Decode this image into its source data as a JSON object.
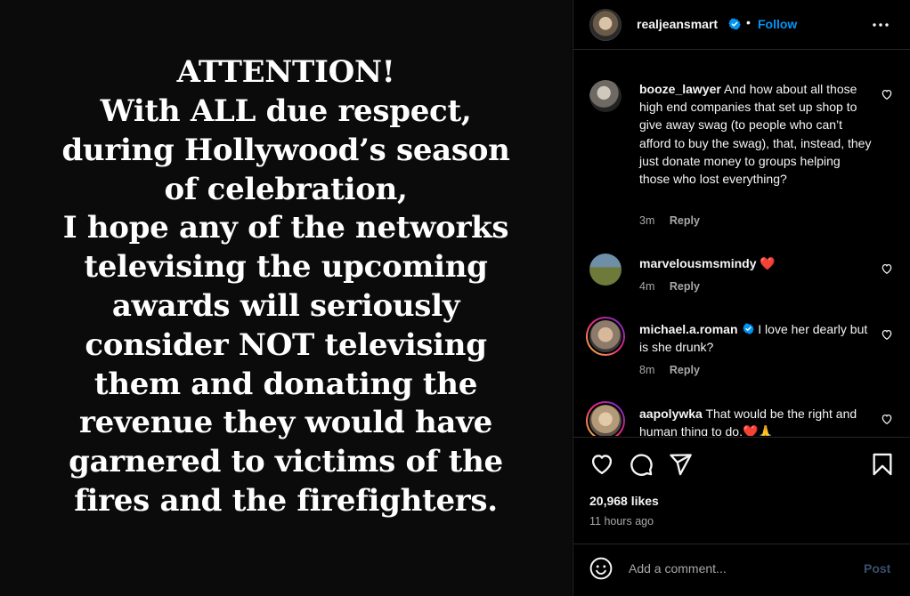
{
  "post": {
    "image_text_lines": [
      "ATTENTION!",
      "With ALL due respect,",
      "during Hollywood’s season",
      "of celebration,",
      "I hope any of the networks",
      "televising the upcoming",
      "awards will seriously",
      "consider NOT televising",
      "them and donating the",
      "revenue they would have",
      "garnered to victims of the",
      "fires and the firefighters."
    ]
  },
  "header": {
    "username": "realjeansmart",
    "separator": "•",
    "follow_label": "Follow",
    "verified": true
  },
  "comments": [
    {
      "username": "booze_lawyer",
      "verified": false,
      "text": "And how about all those high end companies that set up shop to give away swag (to people who can’t afford to buy the swag), that, instead, they just donate money to groups helping those who lost everything?",
      "time": "3m",
      "reply_label": "Reply"
    },
    {
      "username": "marvelousmsmindy",
      "verified": false,
      "text": "❤️",
      "time": "4m",
      "reply_label": "Reply"
    },
    {
      "username": "michael.a.roman",
      "verified": true,
      "text": "I love her dearly but is she drunk?",
      "time": "8m",
      "reply_label": "Reply"
    },
    {
      "username": "aapolywka",
      "verified": false,
      "text": "That would be the right and human thing to do.❤️🙏",
      "time": "",
      "reply_label": ""
    }
  ],
  "stats": {
    "likes": "20,968 likes",
    "time_ago": "11 hours ago"
  },
  "composer": {
    "placeholder": "Add a comment...",
    "post_label": "Post"
  },
  "colors": {
    "background": "#000000",
    "text": "#f5f5f5",
    "muted": "#a8a8a8",
    "link_blue": "#0095f6",
    "heart_red": "#ff3040",
    "divider": "#262626"
  }
}
